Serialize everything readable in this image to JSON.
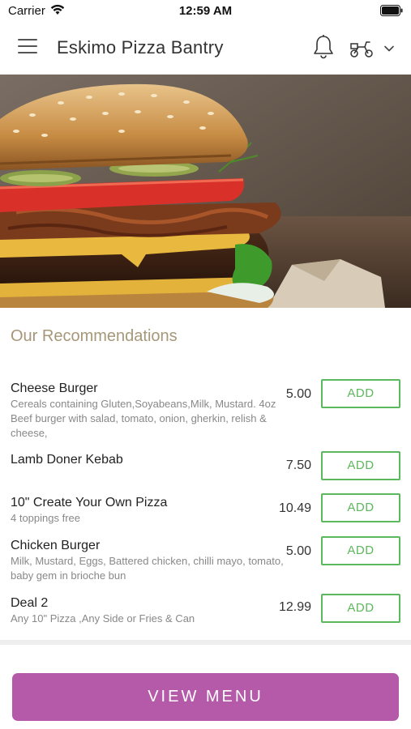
{
  "status_bar": {
    "carrier": "Carrier",
    "time": "12:59 AM"
  },
  "header": {
    "title": "Eskimo Pizza Bantry"
  },
  "recommendations": {
    "title": "Our Recommendations",
    "items": [
      {
        "name": "Cheese Burger",
        "description": "Cereals containing Gluten,Soyabeans,Milk, Mustard. 4oz Beef burger with salad, tomato, onion, gherkin, relish & cheese,",
        "price": "5.00",
        "add_label": "ADD"
      },
      {
        "name": "Lamb Doner Kebab",
        "description": "",
        "price": "7.50",
        "add_label": "ADD"
      },
      {
        "name": "10\" Create Your Own Pizza",
        "description": "4 toppings free",
        "price": "10.49",
        "add_label": "ADD"
      },
      {
        "name": "Chicken Burger",
        "description": "Milk, Mustard, Eggs, Battered chicken, chilli mayo, tomato, baby gem in brioche bun",
        "price": "5.00",
        "add_label": "ADD"
      },
      {
        "name": "Deal 2",
        "description": "Any 10\" Pizza ,Any Side or Fries & Can",
        "price": "12.99",
        "add_label": "ADD"
      }
    ]
  },
  "footer": {
    "view_menu_label": "VIEW MENU"
  },
  "colors": {
    "accent_purple": "#b45aa9",
    "add_green": "#5cb85c",
    "section_title": "#a69779"
  }
}
